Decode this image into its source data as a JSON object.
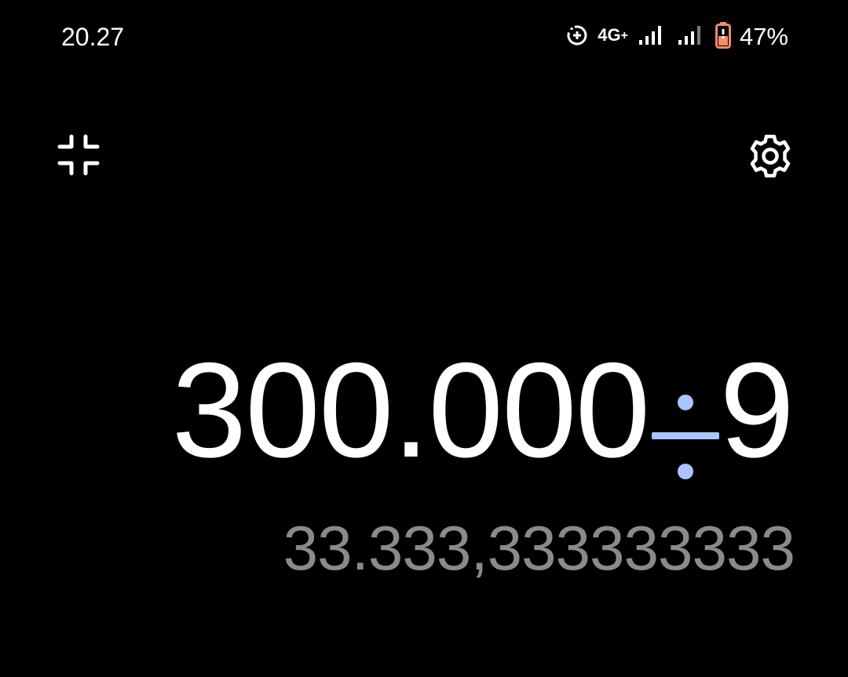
{
  "status_bar": {
    "time": "20.27",
    "network_type": "4G",
    "network_plus": "+",
    "battery_percent": "47%",
    "battery_color": "#f28b6d",
    "icons": [
      "data-saver-icon",
      "signal-strength-icon",
      "signal-strength-icon-sim2",
      "battery-icon"
    ]
  },
  "toolbar": {
    "collapse_icon": "collapse-icon",
    "settings_icon": "gear-icon"
  },
  "display": {
    "operand_1": "300.000",
    "operator": "÷",
    "operand_2": "9",
    "operator_color": "#a9c4ff",
    "result": "33.333,333333333",
    "result_color": "#8a8a8a"
  }
}
